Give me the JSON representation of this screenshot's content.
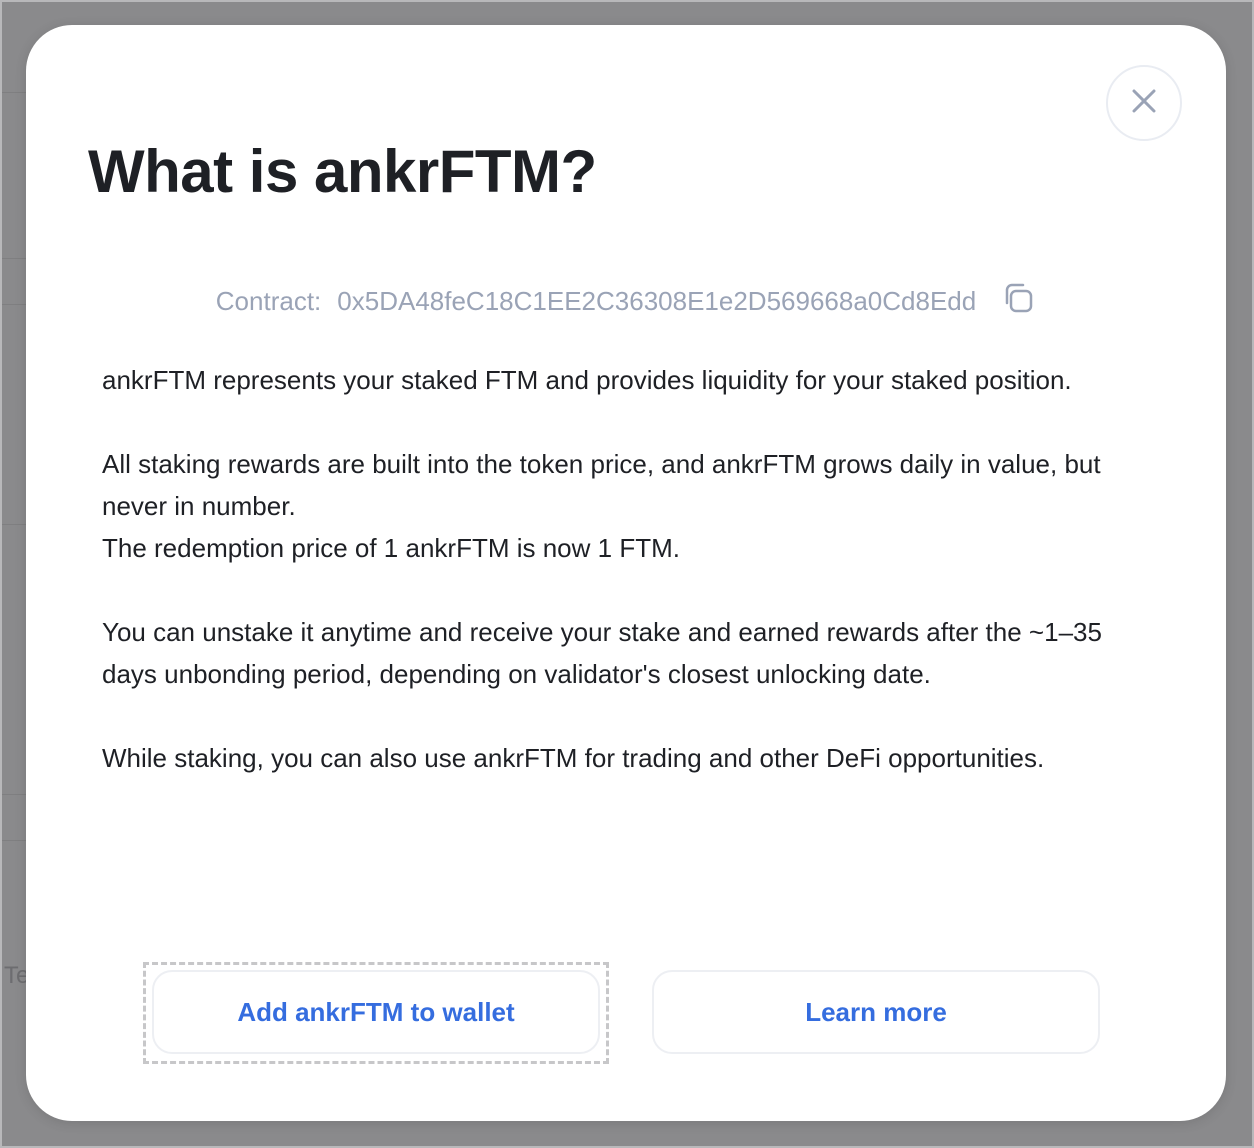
{
  "background": {
    "fragment_text": "Te"
  },
  "modal": {
    "title": "What is ankrFTM?",
    "close_icon": "close-icon",
    "contract": {
      "label": "Contract:",
      "address": "0x5DA48feC18C1EE2C36308E1e2D569668a0Cd8Edd",
      "copy_icon": "copy-icon"
    },
    "paragraphs": {
      "p1": "ankrFTM represents your staked FTM and provides liquidity for your staked position.",
      "p2a": "All staking rewards are built into the token price, and ankrFTM grows daily in value, but never in number.",
      "p2b": "The redemption price of 1 ankrFTM is now 1 FTM.",
      "p3": "You can unstake it anytime and receive your stake and earned rewards after the ~1–35 days unbonding period, depending on validator's closest unlocking date.",
      "p4": "While staking, you can also use ankrFTM for trading and other DeFi opportunities."
    },
    "buttons": {
      "add_wallet": "Add ankrFTM to wallet",
      "learn_more": "Learn more"
    }
  },
  "colors": {
    "backdrop": "#8a8a8c",
    "title": "#1e2025",
    "muted": "#9aa3b6",
    "accent": "#356ddf"
  }
}
